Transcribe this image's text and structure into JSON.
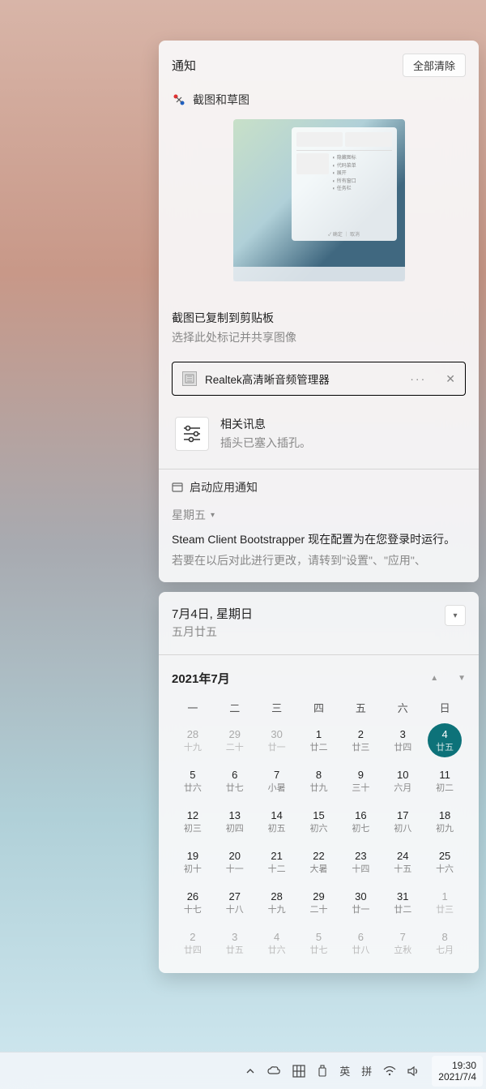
{
  "notifications": {
    "title": "通知",
    "clear_all": "全部清除",
    "snip": {
      "app": "截图和草图",
      "title": "截图已复制到剪贴板",
      "subtitle": "选择此处标记并共享图像"
    },
    "realtek": {
      "app": "Realtek高清晰音频管理器",
      "info_title": "相关讯息",
      "info_sub": "插头已塞入插孔。"
    },
    "startup": {
      "app": "启动应用通知",
      "day": "星期五",
      "text": "Steam Client Bootstrapper 现在配置为在您登录时运行。",
      "sub": "若要在以后对此进行更改，请转到\"设置\"、\"应用\"、"
    }
  },
  "calendar": {
    "date_main": "7月4日, 星期日",
    "date_sub": "五月廿五",
    "month": "2021年7月",
    "weekdays": [
      "一",
      "二",
      "三",
      "四",
      "五",
      "六",
      "日"
    ],
    "days": [
      {
        "n": "28",
        "s": "十九",
        "o": true
      },
      {
        "n": "29",
        "s": "二十",
        "o": true
      },
      {
        "n": "30",
        "s": "廿一",
        "o": true
      },
      {
        "n": "1",
        "s": "廿二"
      },
      {
        "n": "2",
        "s": "廿三"
      },
      {
        "n": "3",
        "s": "廿四"
      },
      {
        "n": "4",
        "s": "廿五",
        "t": true
      },
      {
        "n": "5",
        "s": "廿六"
      },
      {
        "n": "6",
        "s": "廿七"
      },
      {
        "n": "7",
        "s": "小暑"
      },
      {
        "n": "8",
        "s": "廿九"
      },
      {
        "n": "9",
        "s": "三十"
      },
      {
        "n": "10",
        "s": "六月"
      },
      {
        "n": "11",
        "s": "初二"
      },
      {
        "n": "12",
        "s": "初三"
      },
      {
        "n": "13",
        "s": "初四"
      },
      {
        "n": "14",
        "s": "初五"
      },
      {
        "n": "15",
        "s": "初六"
      },
      {
        "n": "16",
        "s": "初七"
      },
      {
        "n": "17",
        "s": "初八"
      },
      {
        "n": "18",
        "s": "初九"
      },
      {
        "n": "19",
        "s": "初十"
      },
      {
        "n": "20",
        "s": "十一"
      },
      {
        "n": "21",
        "s": "十二"
      },
      {
        "n": "22",
        "s": "大暑"
      },
      {
        "n": "23",
        "s": "十四"
      },
      {
        "n": "24",
        "s": "十五"
      },
      {
        "n": "25",
        "s": "十六"
      },
      {
        "n": "26",
        "s": "十七"
      },
      {
        "n": "27",
        "s": "十八"
      },
      {
        "n": "28",
        "s": "十九"
      },
      {
        "n": "29",
        "s": "二十"
      },
      {
        "n": "30",
        "s": "廿一"
      },
      {
        "n": "31",
        "s": "廿二"
      },
      {
        "n": "1",
        "s": "廿三",
        "o": true
      },
      {
        "n": "2",
        "s": "廿四",
        "o": true
      },
      {
        "n": "3",
        "s": "廿五",
        "o": true
      },
      {
        "n": "4",
        "s": "廿六",
        "o": true
      },
      {
        "n": "5",
        "s": "廿七",
        "o": true
      },
      {
        "n": "6",
        "s": "廿八",
        "o": true
      },
      {
        "n": "7",
        "s": "立秋",
        "o": true
      },
      {
        "n": "8",
        "s": "七月",
        "o": true
      }
    ]
  },
  "taskbar": {
    "ime1": "英",
    "ime2": "拼",
    "time": "19:30",
    "date": "2021/7/4"
  }
}
